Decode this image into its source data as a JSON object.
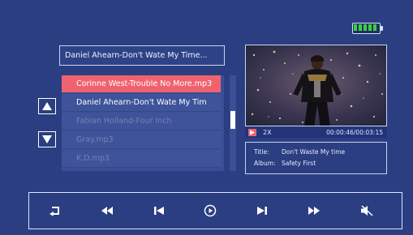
{
  "status": {
    "battery_level": 1.0,
    "battery_color": "#36d43a"
  },
  "now_playing": {
    "text": "Daniel Ahearn-Don't Wate My Time..."
  },
  "playlist": {
    "items": [
      {
        "label": "Corinne West-Trouble No More.mp3",
        "state": "selected"
      },
      {
        "label": "Daniel Ahearn-Don't Wate My Tim",
        "state": "active"
      },
      {
        "label": "Fabian Holland-Four Inch",
        "state": "dim"
      },
      {
        "label": "Gray.mp3",
        "state": "dim"
      },
      {
        "label": "K.D.mp3",
        "state": "dim"
      }
    ]
  },
  "navigation": {
    "up_icon": "triangle-up-icon",
    "down_icon": "triangle-down-icon"
  },
  "video": {
    "speed": "2X",
    "elapsed_total": "00:00:46/00:03:15",
    "accent_color": "#f0636e"
  },
  "info": {
    "title_label": "Title:",
    "title_value": "Don't Waste My time",
    "album_label": "Album:",
    "album_value": "Safety First"
  },
  "controls": {
    "icons": [
      "return-icon",
      "rewind-icon",
      "previous-icon",
      "play-icon",
      "next-icon",
      "fast-forward-icon",
      "mute-icon"
    ]
  }
}
